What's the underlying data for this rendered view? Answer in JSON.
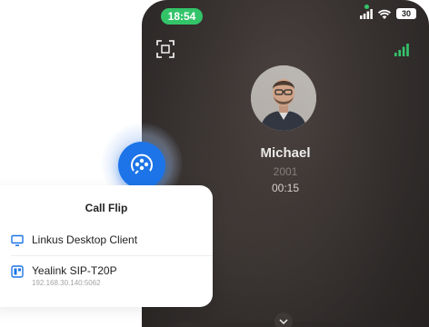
{
  "phone": {
    "time": "18:54",
    "battery": "30",
    "caller": {
      "name": "Michael",
      "number": "2001",
      "duration": "00:15"
    }
  },
  "card": {
    "title": "Call Flip",
    "devices": [
      {
        "label": "Linkus Desktop Client",
        "sub": ""
      },
      {
        "label": "Yealink SIP-T20P",
        "sub": "192.168.30.140:5062"
      }
    ]
  },
  "colors": {
    "accent": "#1c74e8",
    "status_green": "#33c46a"
  }
}
